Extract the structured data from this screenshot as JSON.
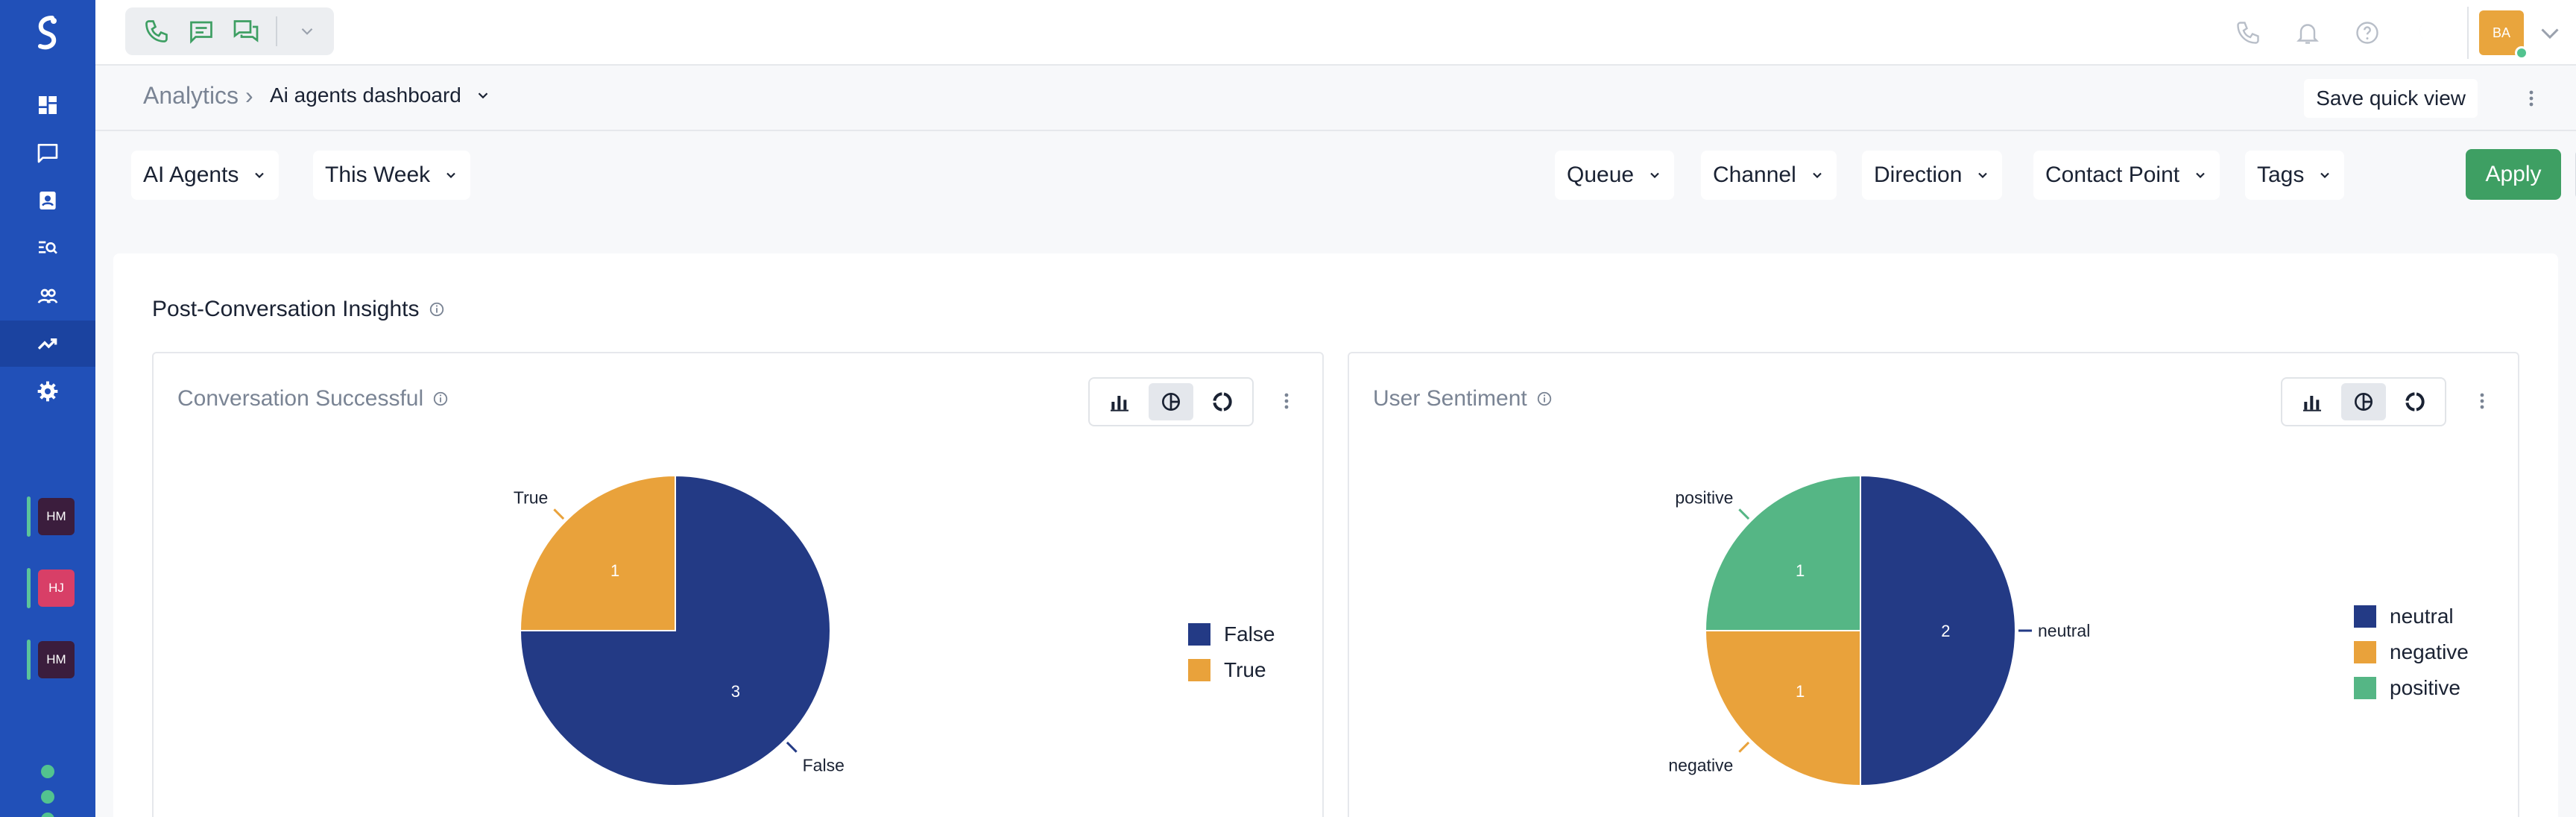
{
  "rail": {
    "nav": [
      "dashboard-icon",
      "conversations-icon",
      "contacts-icon",
      "search-list-icon",
      "users-icon",
      "analytics-icon",
      "settings-icon"
    ],
    "agents": [
      {
        "initials": "HM",
        "color": "#3b1d3d"
      },
      {
        "initials": "HJ",
        "color": "#d83f67"
      },
      {
        "initials": "HM",
        "color": "#3b1d3d"
      }
    ]
  },
  "topbar": {
    "avatar_initials": "BA"
  },
  "breadcrumb": {
    "root": "Analytics ›",
    "current": "Ai agents dashboard"
  },
  "actions": {
    "save_quick_view": "Save quick view"
  },
  "filters": {
    "left": [
      "AI Agents",
      "This Week"
    ],
    "right": [
      "Queue",
      "Channel",
      "Direction",
      "Contact Point",
      "Tags"
    ],
    "apply": "Apply"
  },
  "section": {
    "title": "Post-Conversation Insights"
  },
  "colors": {
    "navy": "#233a85",
    "orange": "#e9a23b",
    "green": "#55b685",
    "apply_green": "#3e9f63",
    "rail_blue": "#2150b8"
  },
  "chart_data": [
    {
      "type": "pie",
      "title": "Conversation Successful",
      "categories": [
        "False",
        "True"
      ],
      "values": [
        3,
        1
      ],
      "colors": [
        "#233a85",
        "#e9a23b"
      ],
      "legend": [
        "False",
        "True"
      ],
      "legend_position": "right"
    },
    {
      "type": "pie",
      "title": "User Sentiment",
      "categories": [
        "neutral",
        "negative",
        "positive"
      ],
      "values": [
        2,
        1,
        1
      ],
      "colors": [
        "#233a85",
        "#e9a23b",
        "#55b685"
      ],
      "legend": [
        "neutral",
        "negative",
        "positive"
      ],
      "legend_position": "right"
    }
  ]
}
